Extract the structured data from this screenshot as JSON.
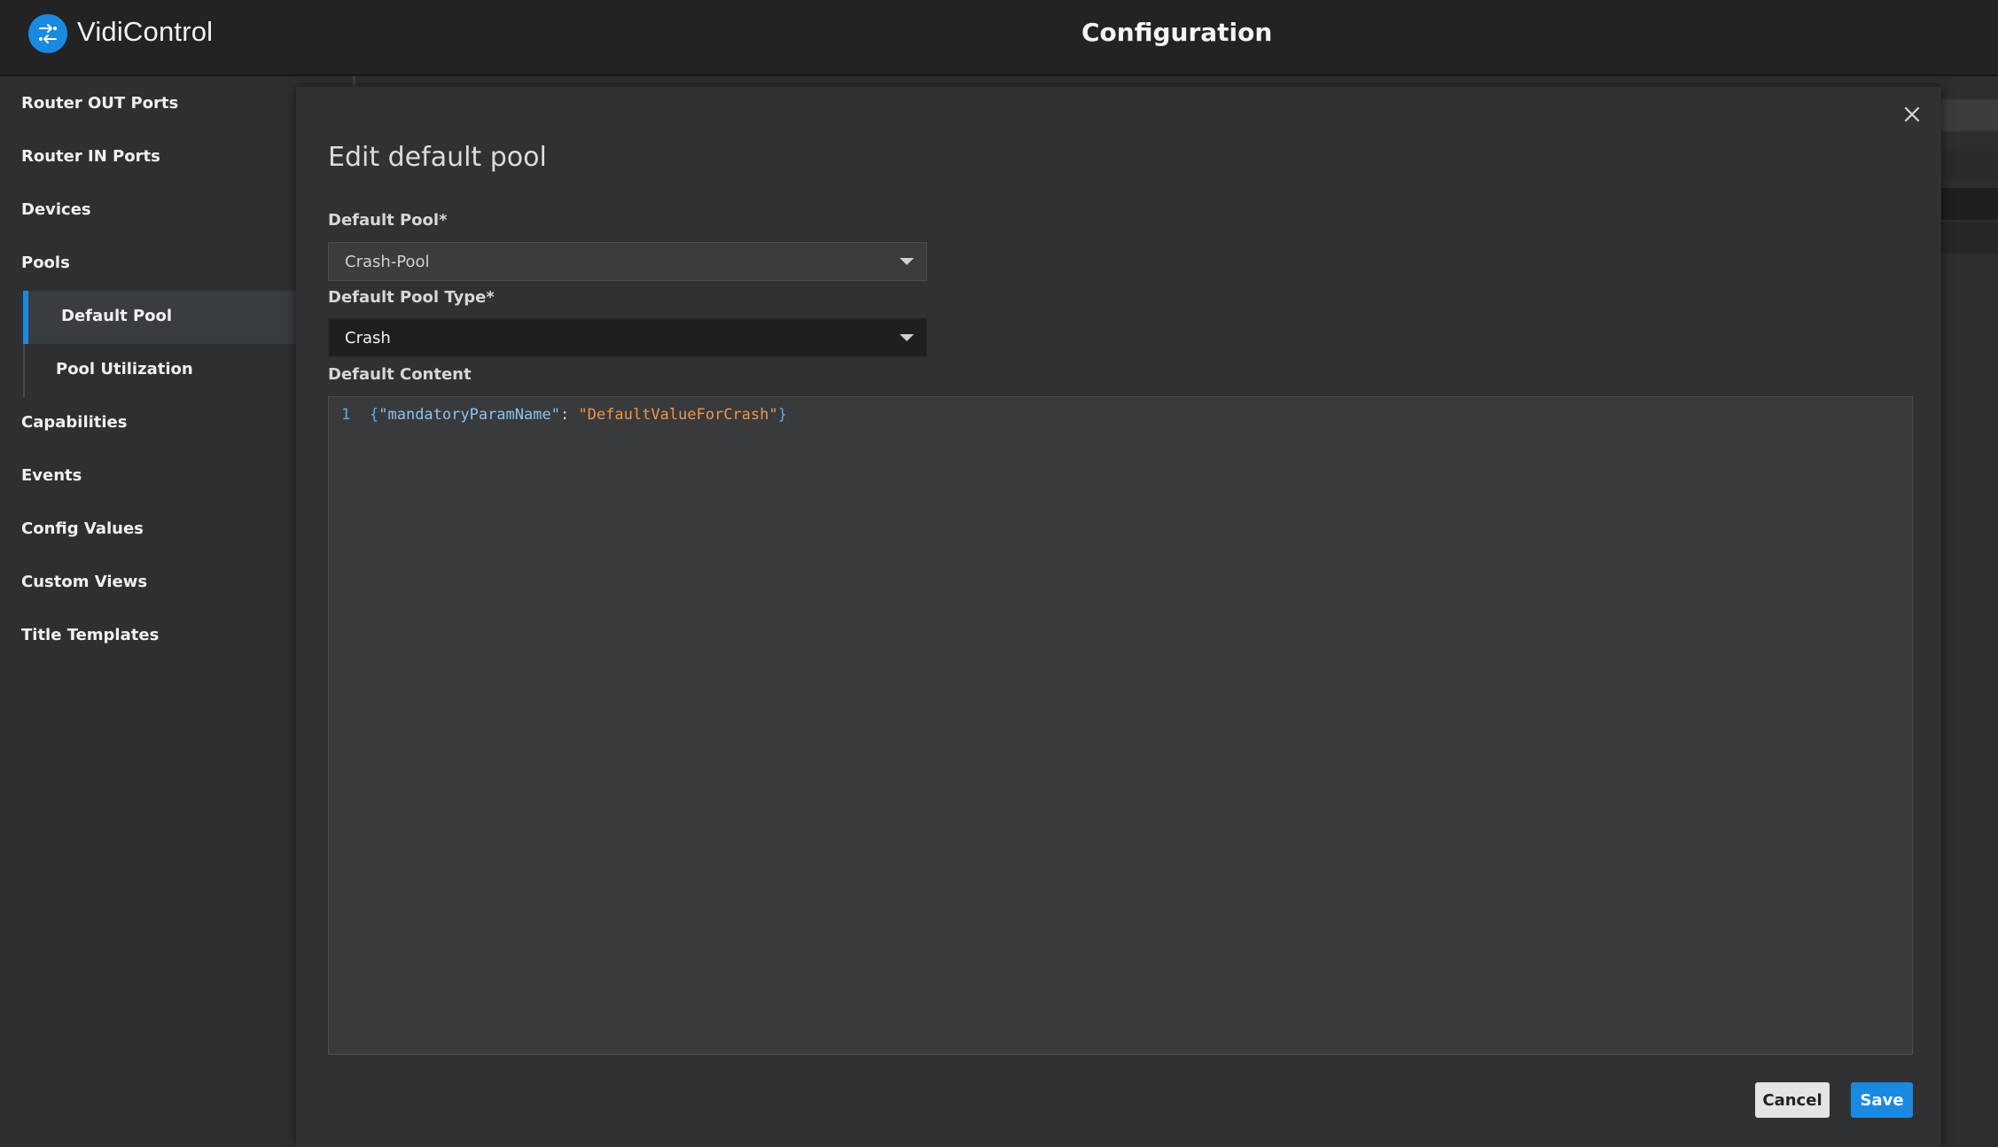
{
  "header": {
    "brand": "VidiControl",
    "title": "Configuration",
    "logo_icon": "vidicontrol-logo-icon",
    "accent_color": "#1a8ae0"
  },
  "sidebar": {
    "items": [
      {
        "label": "Router OUT Ports"
      },
      {
        "label": "Router IN Ports"
      },
      {
        "label": "Devices"
      },
      {
        "label": "Pools"
      },
      {
        "label": "Default Pool",
        "active": true,
        "sub": true
      },
      {
        "label": "Pool Utilization",
        "sub": true
      },
      {
        "label": "Capabilities"
      },
      {
        "label": "Events"
      },
      {
        "label": "Config Values"
      },
      {
        "label": "Custom Views"
      },
      {
        "label": "Title Templates"
      }
    ]
  },
  "modal": {
    "title": "Edit default pool",
    "close_icon": "close-icon",
    "fields": {
      "default_pool": {
        "label": "Default Pool*",
        "value": "Crash-Pool"
      },
      "default_pool_type": {
        "label": "Default Pool Type*",
        "value": "Crash"
      },
      "default_content": {
        "label": "Default Content",
        "line_number": "1",
        "code": {
          "open": "{",
          "key": "\"mandatoryParamName\"",
          "sep": ": ",
          "value": "\"DefaultValueForCrash\"",
          "close": "}"
        }
      }
    },
    "buttons": {
      "cancel": "Cancel",
      "save": "Save"
    }
  }
}
